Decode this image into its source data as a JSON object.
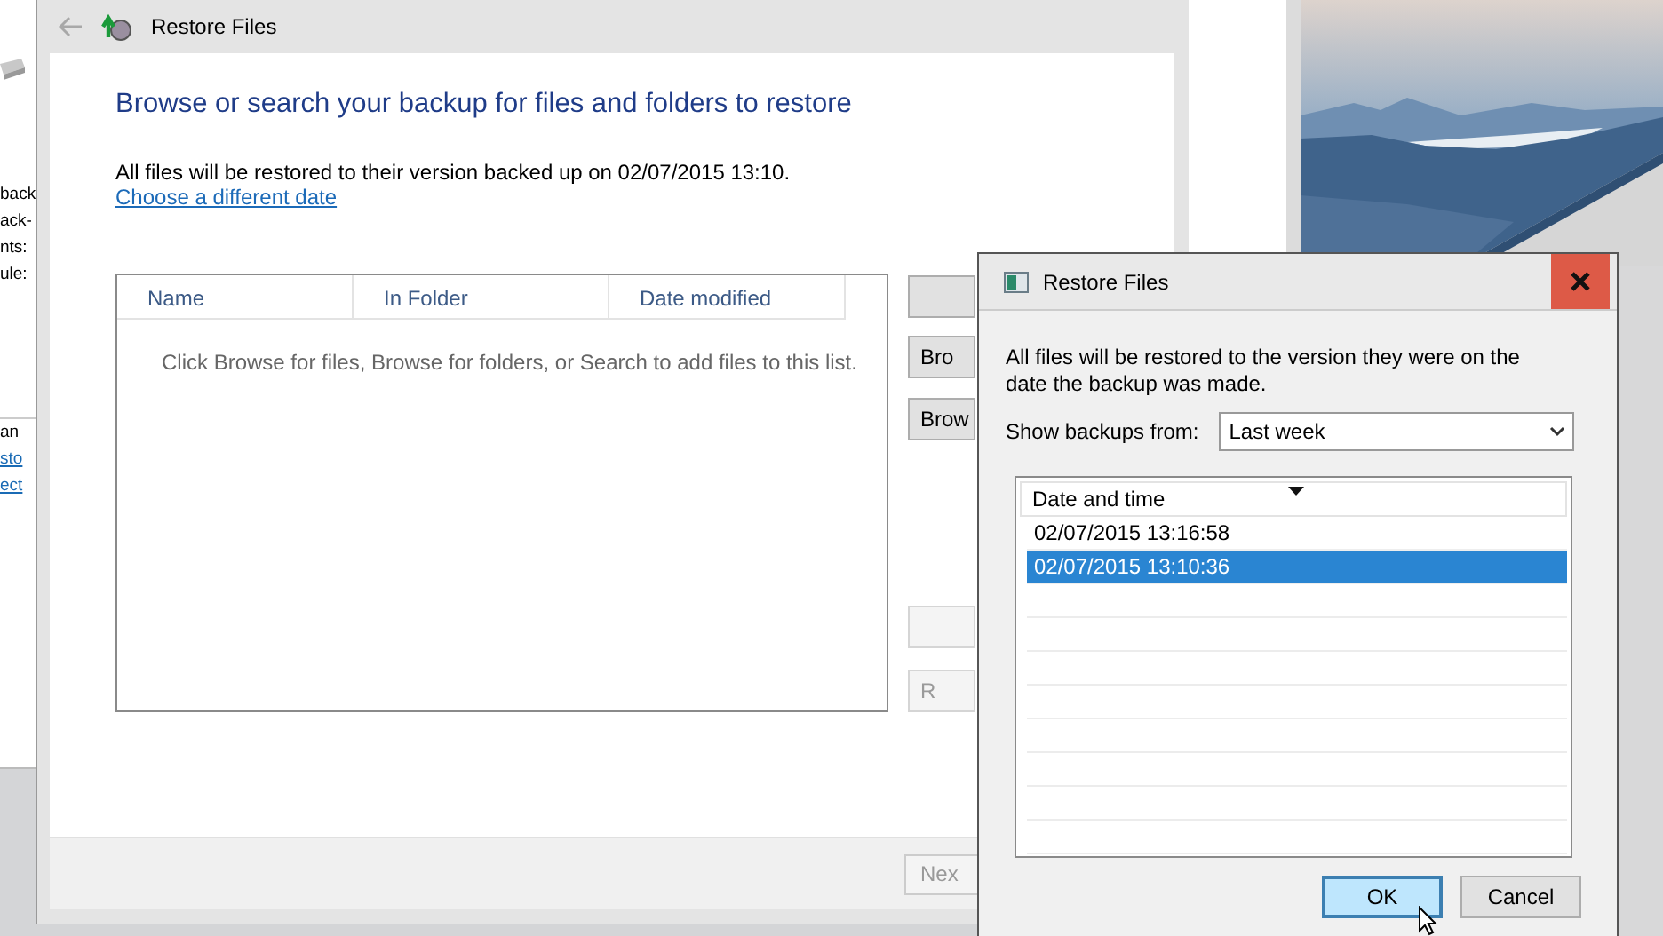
{
  "background_window": {
    "lines": [
      {
        "text": "back",
        "kind": "text"
      },
      {
        "text": "ack-",
        "kind": "text"
      },
      {
        "text": "nts:",
        "kind": "text"
      },
      {
        "text": "ule:",
        "kind": "text"
      }
    ],
    "lower_lines": [
      {
        "text": "an",
        "kind": "text"
      },
      {
        "text": "sto",
        "kind": "link"
      },
      {
        "text": "ect",
        "kind": "link"
      }
    ]
  },
  "main_window": {
    "title": "Restore Files",
    "heading": "Browse or search your backup for files and folders to restore",
    "info": "All files will be restored to their version backed up on 02/07/2015 13:10.",
    "link": "Choose a different date",
    "table": {
      "columns": [
        "Name",
        "In Folder",
        "Date modified"
      ],
      "empty_message": "Click Browse for files, Browse for folders, or Search to add files to this list."
    },
    "side_buttons": [
      {
        "disabled": false
      },
      {
        "label": "Bro",
        "disabled": false
      },
      {
        "label": "Brow",
        "disabled": false
      },
      {
        "disabled": true
      },
      {
        "label": "R",
        "disabled": true
      }
    ],
    "next_button": {
      "label": "Nex",
      "disabled": true
    }
  },
  "dialog": {
    "title": "Restore Files",
    "message": "All files will be restored to the version they were on the date the backup was made.",
    "show_label": "Show backups from:",
    "dropdown": {
      "value": "Last week"
    },
    "list": {
      "column": "Date and time",
      "rows": [
        {
          "text": "02/07/2015 13:16:58",
          "selected": false
        },
        {
          "text": "02/07/2015 13:10:36",
          "selected": true
        }
      ]
    },
    "buttons": [
      {
        "label": "OK",
        "default": true
      },
      {
        "label": "Cancel",
        "default": false
      }
    ]
  }
}
